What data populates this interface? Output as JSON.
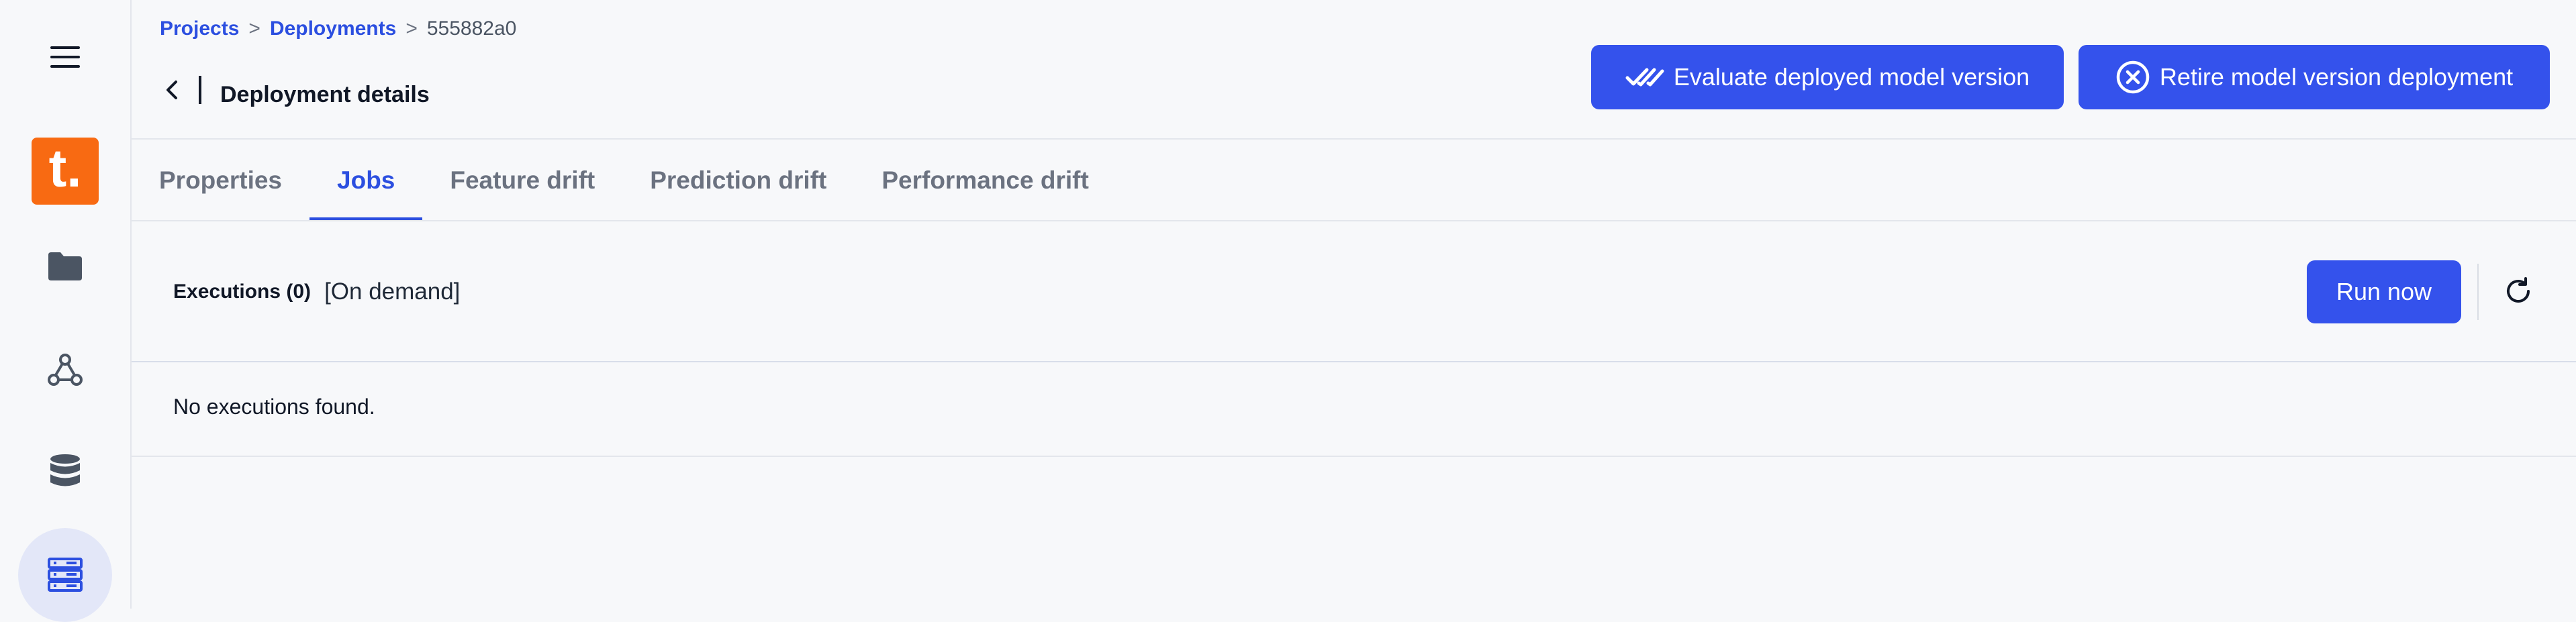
{
  "sidebar": {
    "logo_text": "t.",
    "logo_color": "#f86a12",
    "items": [
      {
        "name": "menu-icon"
      },
      {
        "name": "folder-icon"
      },
      {
        "name": "pipelines-icon"
      },
      {
        "name": "database-icon"
      },
      {
        "name": "server-icon",
        "active": true
      }
    ]
  },
  "breadcrumb": {
    "items": [
      "Projects",
      "Deployments",
      "555882a0"
    ],
    "separator": ">"
  },
  "header": {
    "title": "Deployment details",
    "evaluate_label": "Evaluate deployed model version",
    "retire_label": "Retire model version deployment"
  },
  "tabs": [
    {
      "label": "Properties",
      "active": false
    },
    {
      "label": "Jobs",
      "active": true
    },
    {
      "label": "Feature drift",
      "active": false
    },
    {
      "label": "Prediction drift",
      "active": false
    },
    {
      "label": "Performance drift",
      "active": false
    }
  ],
  "executions": {
    "title": "Executions (0)",
    "mode": "[On demand]",
    "run_label": "Run now",
    "empty_message": "No executions found."
  },
  "colors": {
    "accent": "#3452ec",
    "link": "#2c4fe0",
    "active_nav_bg": "#e3e7f8"
  }
}
